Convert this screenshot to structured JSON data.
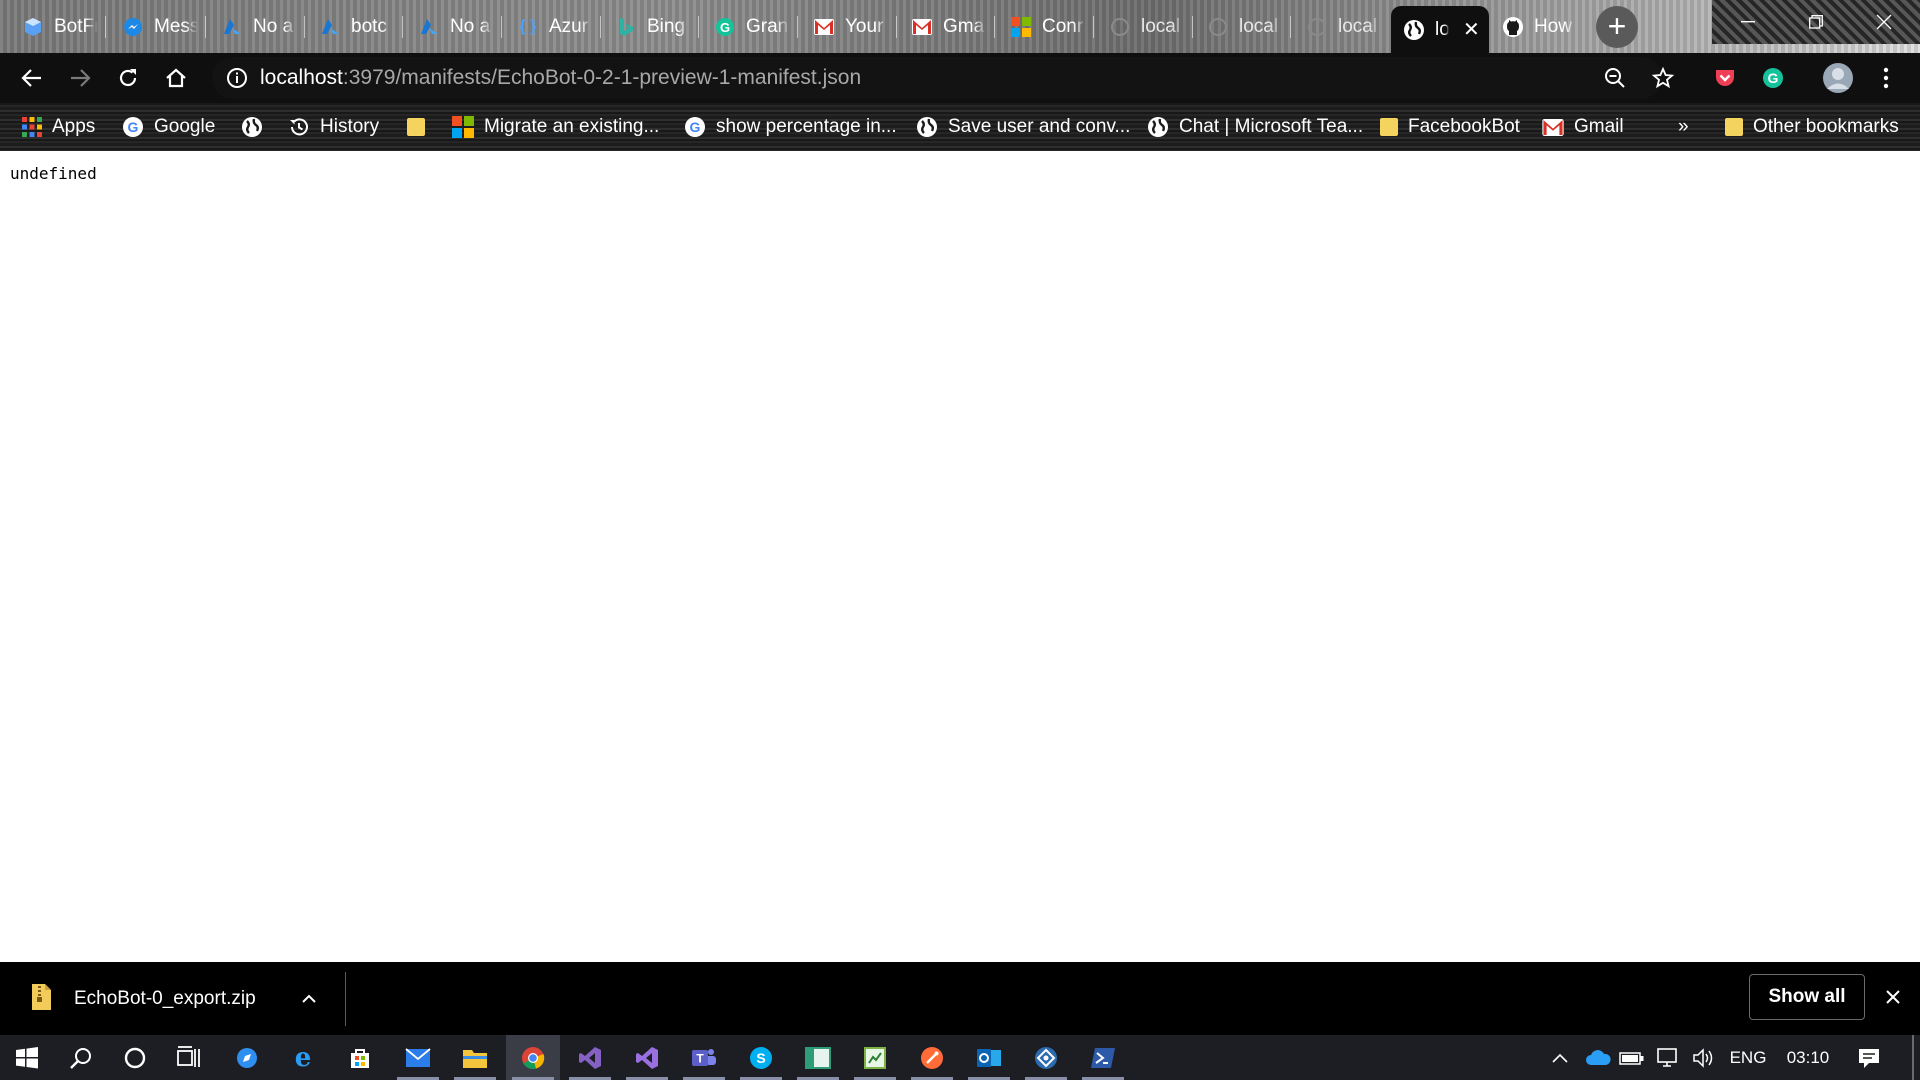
{
  "tabs": [
    {
      "label": "BotFr",
      "icon": "box-icon",
      "color": "#3b82f6"
    },
    {
      "label": "Mess",
      "icon": "messenger-icon",
      "color": "#1e88e5"
    },
    {
      "label": "No a",
      "icon": "azure-icon",
      "color": "#1976d2"
    },
    {
      "label": "botc",
      "icon": "azure-icon",
      "color": "#1976d2"
    },
    {
      "label": "No a",
      "icon": "azure-icon",
      "color": "#1976d2"
    },
    {
      "label": "Azur",
      "icon": "azure-functions-icon",
      "color": "#3b82f6"
    },
    {
      "label": "Bing",
      "icon": "bing-icon",
      "color": "#138a8a"
    },
    {
      "label": "Gran",
      "icon": "grammarly-icon",
      "color": "#15c39a"
    },
    {
      "label": "Your",
      "icon": "gmail-icon",
      "color": "#d93025"
    },
    {
      "label": "Gma",
      "icon": "gmail-icon",
      "color": "#d93025"
    },
    {
      "label": "Conr",
      "icon": "microsoft-icon",
      "color": "#f25022"
    },
    {
      "label": "local",
      "icon": "loading-icon",
      "color": "#8a8a8a"
    },
    {
      "label": "local",
      "icon": "loading-icon",
      "color": "#8a8a8a"
    },
    {
      "label": "local",
      "icon": "loading-icon",
      "color": "#8a8a8a"
    },
    {
      "label": "lo",
      "icon": "globe-icon",
      "color": "#ffffff",
      "active": true
    },
    {
      "label": "How",
      "icon": "github-icon",
      "color": "#ffffff"
    }
  ],
  "toolbar": {
    "url_host": "localhost",
    "url_rest": ":3979/manifests/EchoBot-0-2-1-preview-1-manifest.json"
  },
  "bookmarks": [
    {
      "label": "Apps",
      "icon": "apps-grid-icon"
    },
    {
      "label": "Google",
      "icon": "google-icon"
    },
    {
      "label": "",
      "icon": "globe-icon"
    },
    {
      "label": "History",
      "icon": "history-icon"
    },
    {
      "label": "",
      "icon": "folder-icon"
    },
    {
      "label": "Migrate an existing...",
      "icon": "microsoft-icon"
    },
    {
      "label": "show percentage in...",
      "icon": "google-icon"
    },
    {
      "label": "Save user and conv...",
      "icon": "globe-icon"
    },
    {
      "label": "Chat | Microsoft Tea...",
      "icon": "globe-icon"
    },
    {
      "label": "FacebookBot",
      "icon": "folder-icon"
    },
    {
      "label": "Gmail",
      "icon": "gmail-icon"
    },
    {
      "label": "»",
      "icon": ""
    },
    {
      "label": "Other bookmarks",
      "icon": "folder-icon"
    }
  ],
  "page": {
    "text": "undefined"
  },
  "downloads": {
    "file_name": "EchoBot-0_export.zip",
    "show_all": "Show all"
  },
  "taskbar": {
    "apps": [
      {
        "icon": "windows-start-icon",
        "color": "#ffffff"
      },
      {
        "icon": "search-icon",
        "color": "#ffffff"
      },
      {
        "icon": "cortana-icon",
        "color": "#ffffff"
      },
      {
        "icon": "task-view-icon",
        "color": "#ffffff"
      },
      {
        "icon": "safari-like-icon",
        "color": "#2f8ff0"
      },
      {
        "icon": "edge-icon",
        "color": "#1e90ff"
      },
      {
        "icon": "store-icon",
        "color": "#ffffff"
      },
      {
        "icon": "mail-icon",
        "color": "#2b7de9"
      },
      {
        "icon": "file-explorer-icon",
        "color": "#f3c53c"
      },
      {
        "icon": "chrome-icon",
        "color": "#db4437"
      },
      {
        "icon": "visual-studio-icon",
        "color": "#8661c5"
      },
      {
        "icon": "visual-studio-icon",
        "color": "#8661c5"
      },
      {
        "icon": "teams-icon",
        "color": "#5b5fc7"
      },
      {
        "icon": "skype-icon",
        "color": "#00aff0"
      },
      {
        "icon": "window-app-icon",
        "color": "#2d9d78"
      },
      {
        "icon": "notes-app-icon",
        "color": "#7cb342"
      },
      {
        "icon": "postman-icon",
        "color": "#ff6c37"
      },
      {
        "icon": "outlook-icon",
        "color": "#0a64b4"
      },
      {
        "icon": "bot-emulator-icon",
        "color": "#2b6cb0"
      },
      {
        "icon": "powershell-icon",
        "color": "#2d5aa8"
      }
    ],
    "language": "ENG",
    "time": "03:10"
  }
}
